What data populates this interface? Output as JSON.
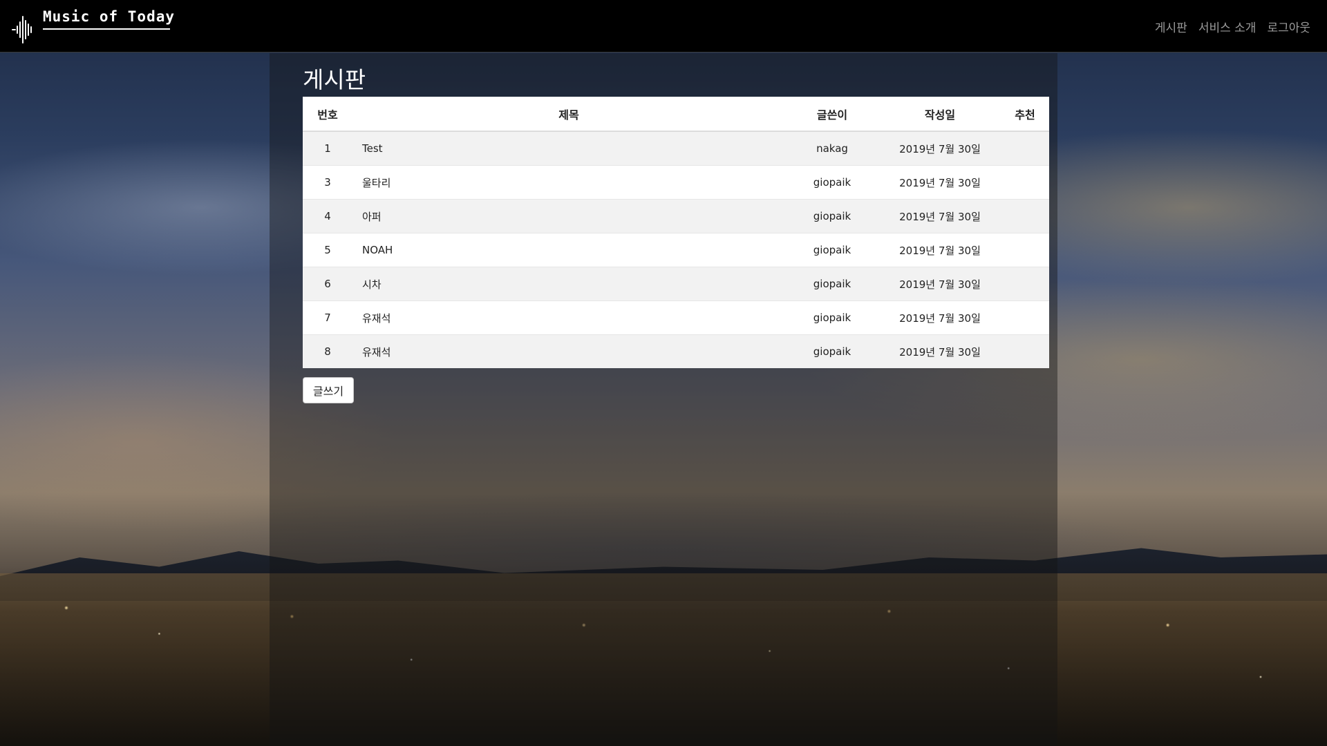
{
  "header": {
    "logo_text": "Music of Today",
    "nav": [
      "게시판",
      "서비스 소개",
      "로그아웃"
    ]
  },
  "main": {
    "title": "게시판",
    "columns": [
      "번호",
      "제목",
      "글쓴이",
      "작성일",
      "추천"
    ],
    "rows": [
      {
        "no": "1",
        "title": "Test",
        "writer": "nakag",
        "date": "2019년 7월 30일",
        "rec": ""
      },
      {
        "no": "3",
        "title": "울타리",
        "writer": "giopaik",
        "date": "2019년 7월 30일",
        "rec": ""
      },
      {
        "no": "4",
        "title": "아퍼",
        "writer": "giopaik",
        "date": "2019년 7월 30일",
        "rec": ""
      },
      {
        "no": "5",
        "title": "NOAH",
        "writer": "giopaik",
        "date": "2019년 7월 30일",
        "rec": ""
      },
      {
        "no": "6",
        "title": "시차",
        "writer": "giopaik",
        "date": "2019년 7월 30일",
        "rec": ""
      },
      {
        "no": "7",
        "title": "유재석",
        "writer": "giopaik",
        "date": "2019년 7월 30일",
        "rec": ""
      },
      {
        "no": "8",
        "title": "유재석",
        "writer": "giopaik",
        "date": "2019년 7월 30일",
        "rec": ""
      }
    ],
    "write_button": "글쓰기"
  },
  "icons": {
    "logo": "sound-wave-icon"
  },
  "colors": {
    "header_bg": "#000000",
    "nav_text": "#9c9c9c",
    "row_alt": "#f2f2f2"
  }
}
